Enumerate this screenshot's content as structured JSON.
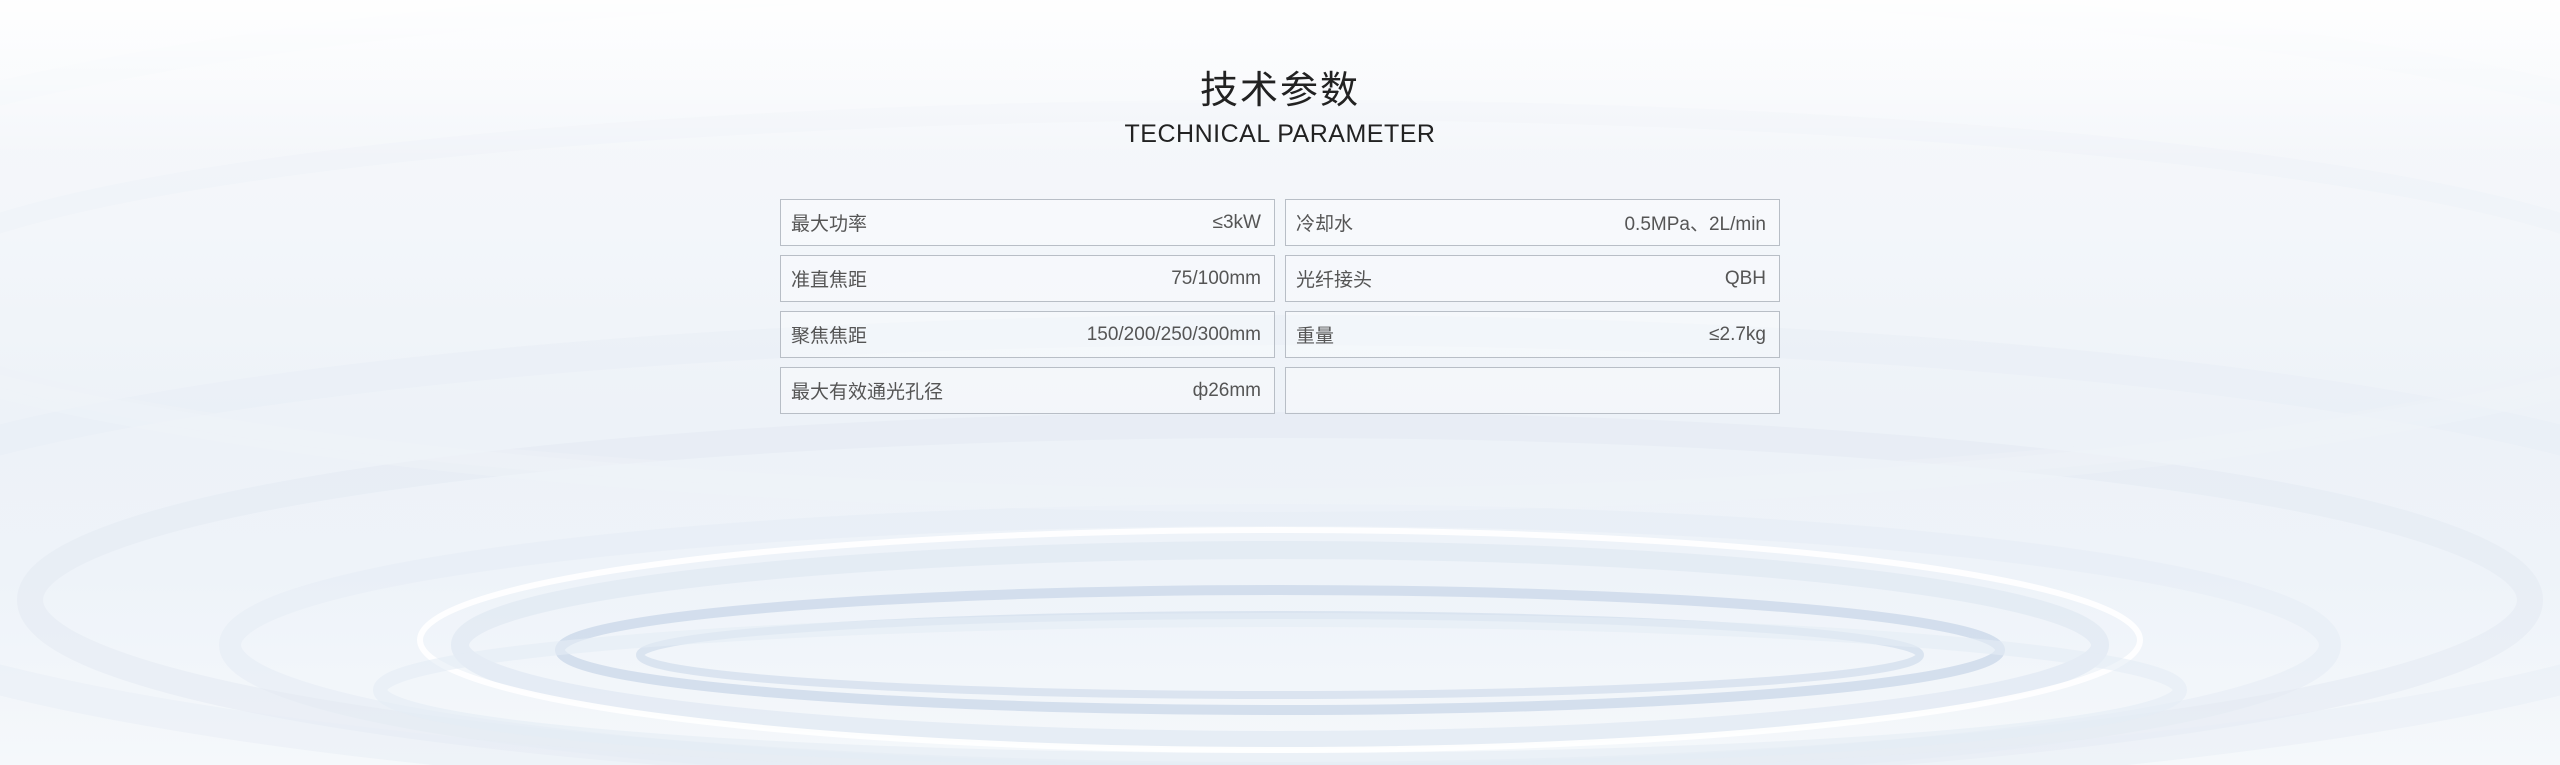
{
  "heading": {
    "title_cn": "技术参数",
    "title_en": "TECHNICAL PARAMETER"
  },
  "params": [
    {
      "label": "最大功率",
      "value": "≤3kW"
    },
    {
      "label": "冷却水",
      "value": "0.5MPa、2L/min"
    },
    {
      "label": "准直焦距",
      "value": "75/100mm"
    },
    {
      "label": "光纤接头",
      "value": "QBH"
    },
    {
      "label": "聚焦焦距",
      "value": "150/200/250/300mm"
    },
    {
      "label": "重量",
      "value": "≤2.7kg"
    },
    {
      "label": "最大有效通光孔径",
      "value": "ф26mm"
    },
    {
      "label": "",
      "value": ""
    }
  ]
}
